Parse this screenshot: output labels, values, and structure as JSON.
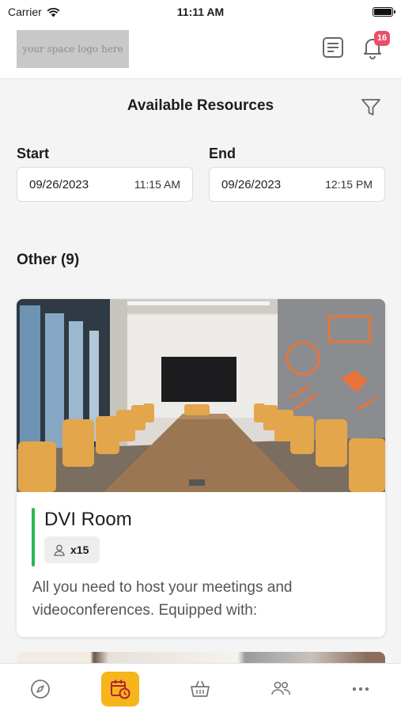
{
  "status_bar": {
    "carrier": "Carrier",
    "time": "11:11 AM"
  },
  "header": {
    "logo_text": "your space logo here",
    "notification_count": "16"
  },
  "page": {
    "title": "Available Resources"
  },
  "start": {
    "label": "Start",
    "date": "09/26/2023",
    "time": "11:15 AM"
  },
  "end": {
    "label": "End",
    "date": "09/26/2023",
    "time": "12:15 PM"
  },
  "section": {
    "title": "Other (9)"
  },
  "card": {
    "title": "DVI Room",
    "capacity": "x15",
    "description": "All you need to host your meetings and videoconferences. Equipped with:",
    "accent_color": "#2cb552"
  },
  "tabs": [
    {
      "icon": "compass-icon",
      "active": false
    },
    {
      "icon": "calendar-clock-icon",
      "active": true
    },
    {
      "icon": "basket-icon",
      "active": false
    },
    {
      "icon": "people-icon",
      "active": false
    },
    {
      "icon": "more-icon",
      "active": false
    }
  ],
  "colors": {
    "accent": "#f5b51b",
    "badge": "#e94f6a",
    "available": "#2cb552"
  }
}
